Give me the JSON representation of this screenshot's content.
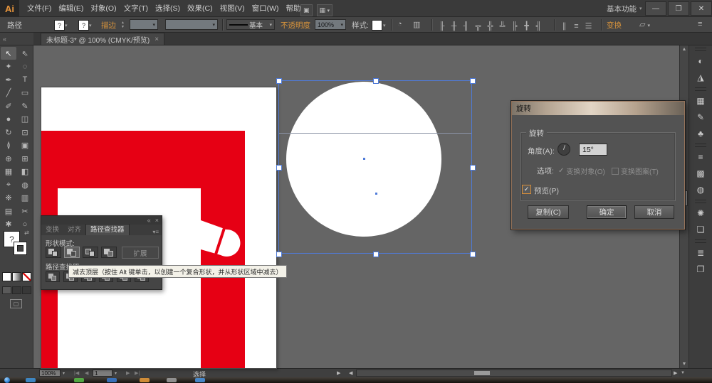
{
  "app": {
    "logo": "Ai",
    "workspace": "基本功能"
  },
  "glyphs": {
    "caret": "▾",
    "collapse": "«",
    "close": "×",
    "minimize": "—",
    "restore": "❐",
    "close_window": "✕",
    "up": "▲",
    "down": "▼",
    "left": "◀",
    "right": "▶",
    "first": "|◀",
    "last": "▶|",
    "question": "?",
    "check": "✓",
    "swap": "⇄",
    "menu": "≡",
    "bridge": "▣",
    "arrange": "▦",
    "recolor": "◔",
    "screen_mode": "▢",
    "shape": "▱",
    "align_opts": "▥"
  },
  "menubar": {
    "items": [
      {
        "name": "menu-file",
        "label": "文件(F)"
      },
      {
        "name": "menu-edit",
        "label": "编辑(E)"
      },
      {
        "name": "menu-object",
        "label": "对象(O)"
      },
      {
        "name": "menu-type",
        "label": "文字(T)"
      },
      {
        "name": "menu-select",
        "label": "选择(S)"
      },
      {
        "name": "menu-effect",
        "label": "效果(C)"
      },
      {
        "name": "menu-view",
        "label": "视图(V)"
      },
      {
        "name": "menu-window",
        "label": "窗口(W)"
      },
      {
        "name": "menu-help",
        "label": "帮助(H)"
      }
    ]
  },
  "controlbar": {
    "title": "路径",
    "stroke_label": "描边",
    "stroke_style": "基本",
    "opacity_label": "不透明度",
    "opacity_value": "100%",
    "style_label": "样式:",
    "transform_label": "变换",
    "align_icons": [
      {
        "name": "h-align-left-icon",
        "glyph": "╟"
      },
      {
        "name": "h-align-center-icon",
        "glyph": "╫"
      },
      {
        "name": "h-align-right-icon",
        "glyph": "╢"
      },
      {
        "name": "v-align-top-icon",
        "glyph": "╦"
      },
      {
        "name": "v-align-center-icon",
        "glyph": "╬"
      },
      {
        "name": "v-align-bottom-icon",
        "glyph": "╩"
      },
      {
        "name": "distribute-top-edge-icon",
        "glyph": "╠"
      },
      {
        "name": "distribute-center-icon",
        "glyph": "╋"
      },
      {
        "name": "distribute-bottom-edge-icon",
        "glyph": "╣"
      }
    ],
    "distribute_icons": [
      {
        "name": "distribute-h-space-icon",
        "glyph": "∥"
      },
      {
        "name": "distribute-v-space-icon",
        "glyph": "≡"
      },
      {
        "name": "distribute-spacing-icon",
        "glyph": "☰"
      }
    ]
  },
  "tabbar": {
    "tab_label": "未标题-3* @ 100% (CMYK/预览)"
  },
  "tools": {
    "items": [
      {
        "name": "selection-tool",
        "glyph": "↖",
        "active": true
      },
      {
        "name": "direct-selection-tool",
        "glyph": "⇖"
      },
      {
        "name": "magic-wand-tool",
        "glyph": "✦"
      },
      {
        "name": "lasso-tool",
        "glyph": "◌"
      },
      {
        "name": "pen-tool",
        "glyph": "✒"
      },
      {
        "name": "type-tool",
        "glyph": "T"
      },
      {
        "name": "line-segment-tool",
        "glyph": "╱"
      },
      {
        "name": "rectangle-tool",
        "glyph": "▭"
      },
      {
        "name": "paintbrush-tool",
        "glyph": "✐"
      },
      {
        "name": "pencil-tool",
        "glyph": "✎"
      },
      {
        "name": "blob-brush-tool",
        "glyph": "●"
      },
      {
        "name": "eraser-tool",
        "glyph": "◫"
      },
      {
        "name": "rotate-tool",
        "glyph": "↻"
      },
      {
        "name": "scale-tool",
        "glyph": "⊡"
      },
      {
        "name": "width-tool",
        "glyph": "≬"
      },
      {
        "name": "free-transform-tool",
        "glyph": "▣"
      },
      {
        "name": "shape-builder-tool",
        "glyph": "⊕"
      },
      {
        "name": "perspective-grid-tool",
        "glyph": "⊞"
      },
      {
        "name": "mesh-tool",
        "glyph": "▦"
      },
      {
        "name": "gradient-tool",
        "glyph": "◧"
      },
      {
        "name": "eyedropper-tool",
        "glyph": "⌖"
      },
      {
        "name": "blend-tool",
        "glyph": "◍"
      },
      {
        "name": "symbol-sprayer-tool",
        "glyph": "❉"
      },
      {
        "name": "column-graph-tool",
        "glyph": "▥"
      },
      {
        "name": "artboard-tool",
        "glyph": "▤"
      },
      {
        "name": "slice-tool",
        "glyph": "✂"
      },
      {
        "name": "hand-tool",
        "glyph": "✱"
      },
      {
        "name": "zoom-tool",
        "glyph": "○"
      }
    ]
  },
  "pathfinder": {
    "tabs": [
      {
        "name": "tab-transform",
        "label": "变换"
      },
      {
        "name": "tab-align",
        "label": "对齐"
      },
      {
        "name": "tab-pathfinder",
        "label": "路径查找器",
        "active": true
      }
    ],
    "shape_modes_label": "形状模式:",
    "expand_button": "扩展",
    "pathfinder_label": "路径查找器:",
    "shape_mode_buttons": [
      {
        "name": "unite-button",
        "variant": "unite"
      },
      {
        "name": "minus-front-button",
        "variant": "minus-front",
        "active": true
      },
      {
        "name": "intersect-button",
        "variant": "intersect"
      },
      {
        "name": "exclude-button",
        "variant": "exclude"
      }
    ],
    "pathfinder_buttons": [
      {
        "name": "divide-button"
      },
      {
        "name": "trim-button"
      },
      {
        "name": "merge-button"
      },
      {
        "name": "crop-button"
      },
      {
        "name": "outline-button"
      },
      {
        "name": "minus-back-button"
      }
    ],
    "tooltip": "减去顶层（按住 Alt 键单击，以创建一个复合形状，并从形状区域中减去）"
  },
  "rotate_dialog": {
    "title": "旋转",
    "group_label": "旋转",
    "angle_label": "角度(A):",
    "angle_value": "15°",
    "options_label": "选项:",
    "option_objects": "变换对象(O)",
    "option_patterns": "变换图案(T)",
    "preview_label": "预览(P)",
    "copy_button": "复制(C)",
    "ok_button": "确定",
    "cancel_button": "取消"
  },
  "statusbar": {
    "zoom": "100%",
    "page": "1",
    "hint": "选择"
  },
  "dock": {
    "icons": [
      {
        "name": "color-panel-icon",
        "glyph": "◐",
        "group": true
      },
      {
        "name": "color-guide-icon",
        "glyph": "◮"
      },
      {
        "name": "swatches-icon",
        "glyph": "▦",
        "group": true
      },
      {
        "name": "brushes-icon",
        "glyph": "✎"
      },
      {
        "name": "symbols-icon",
        "glyph": "♣"
      },
      {
        "name": "stroke-panel-icon",
        "glyph": "≡",
        "group": true
      },
      {
        "name": "gradient-panel-icon",
        "glyph": "▩"
      },
      {
        "name": "transparency-panel-icon",
        "glyph": "◍"
      },
      {
        "name": "appearance-panel-icon",
        "glyph": "✺",
        "group": true
      },
      {
        "name": "graphic-styles-icon",
        "glyph": "❏"
      },
      {
        "name": "layers-panel-icon",
        "glyph": "≣",
        "group": true
      },
      {
        "name": "artboards-panel-icon",
        "glyph": "❐"
      }
    ]
  },
  "taskbar": {
    "icons": [
      {
        "name": "taskbar-app-icon-1",
        "color": "#3f8fd2"
      },
      {
        "name": "taskbar-app-icon-2",
        "color": "#57b547"
      },
      {
        "name": "taskbar-app-icon-3",
        "color": "#3a77c8"
      },
      {
        "name": "taskbar-app-icon-4",
        "color": "#e0973a"
      },
      {
        "name": "taskbar-app-icon-5",
        "color": "#9a9a9a"
      },
      {
        "name": "taskbar-app-icon-6",
        "color": "#4a90d8"
      }
    ]
  },
  "colors": {
    "artwork_red": "#e60014",
    "selection_blue": "#4f7bd9",
    "pasteboard": "#656565"
  }
}
